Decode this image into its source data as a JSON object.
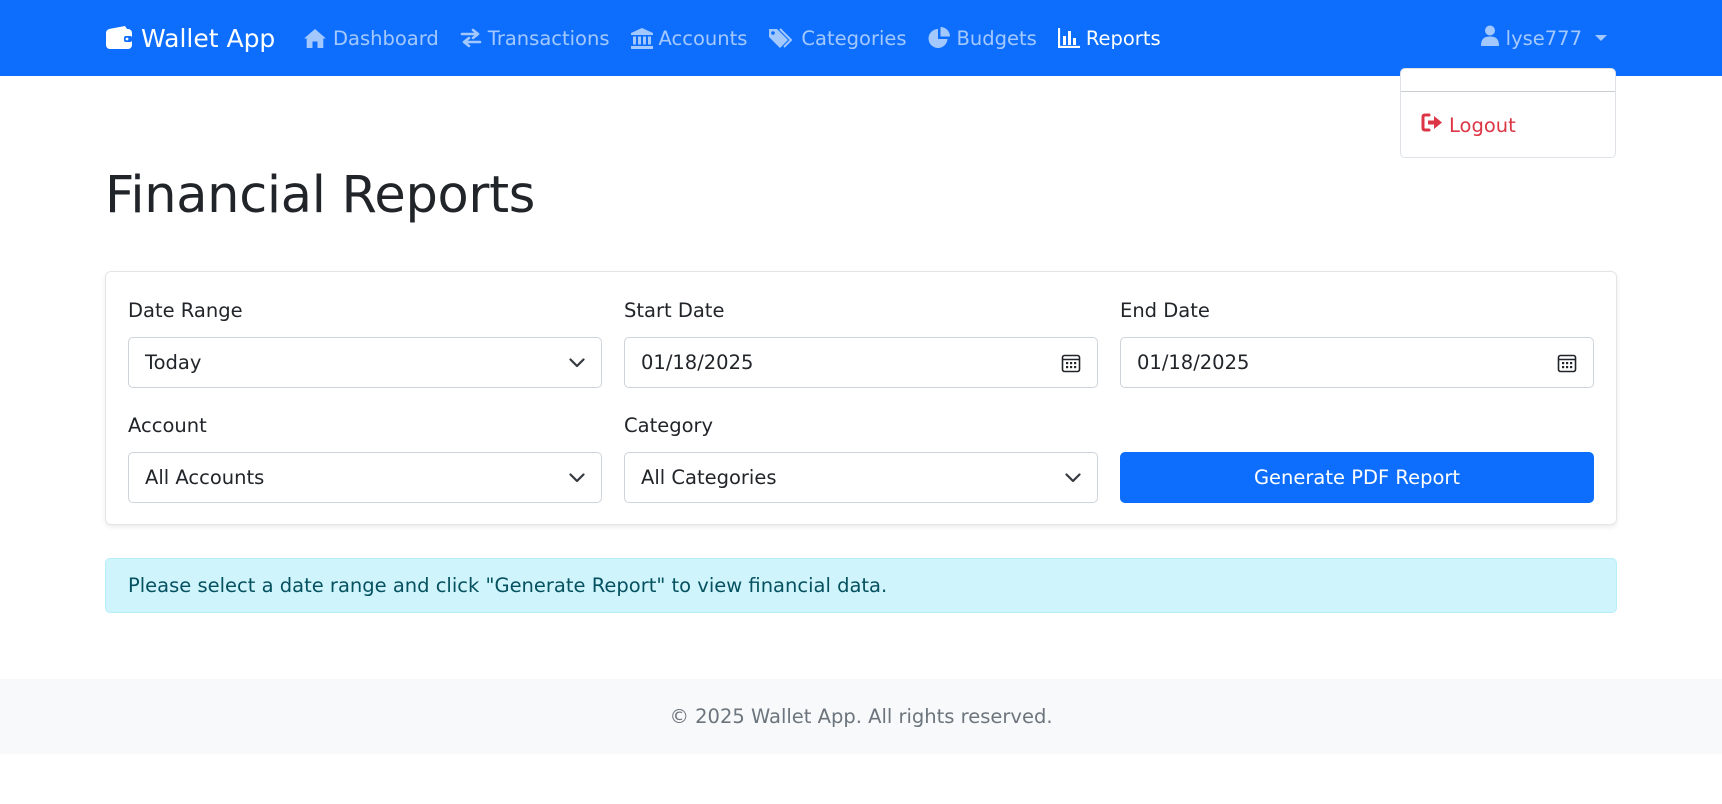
{
  "navbar": {
    "brand": "Wallet App",
    "links": [
      {
        "label": "Dashboard",
        "icon": "home-icon",
        "active": false
      },
      {
        "label": "Transactions",
        "icon": "exchange-icon",
        "active": false
      },
      {
        "label": "Accounts",
        "icon": "bank-icon",
        "active": false
      },
      {
        "label": "Categories",
        "icon": "tags-icon",
        "active": false
      },
      {
        "label": "Budgets",
        "icon": "pie-chart-icon",
        "active": false
      },
      {
        "label": "Reports",
        "icon": "bar-chart-icon",
        "active": true
      }
    ],
    "user": "lyse777"
  },
  "user_menu": {
    "logout_label": "Logout"
  },
  "page": {
    "title": "Financial Reports"
  },
  "filters": {
    "date_range": {
      "label": "Date Range",
      "value": "Today"
    },
    "start_date": {
      "label": "Start Date",
      "value": "01/18/2025"
    },
    "end_date": {
      "label": "End Date",
      "value": "01/18/2025"
    },
    "account": {
      "label": "Account",
      "value": "All Accounts"
    },
    "category": {
      "label": "Category",
      "value": "All Categories"
    },
    "generate_button": "Generate PDF Report"
  },
  "alert": {
    "message": "Please select a date range and click \"Generate Report\" to view financial data."
  },
  "footer": {
    "text": "© 2025 Wallet App. All rights reserved."
  },
  "colors": {
    "primary": "#0d6efd",
    "danger": "#dc3545",
    "info_bg": "#cff4fc",
    "info_text": "#055160"
  }
}
